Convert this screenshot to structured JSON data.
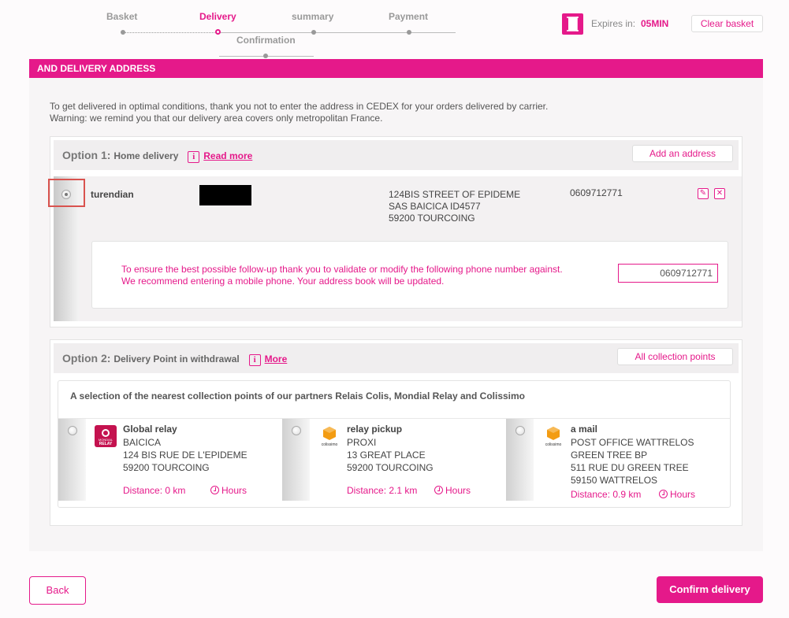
{
  "steps": [
    {
      "label": "Basket"
    },
    {
      "label": "Delivery"
    },
    {
      "label": "summary"
    },
    {
      "label": "Payment"
    },
    {
      "label": "Confirmation"
    }
  ],
  "expire": {
    "label": "Expires in:",
    "value": "05MIN"
  },
  "clear_basket": "Clear basket",
  "panel_title": "AND DELIVERY ADDRESS",
  "intro": [
    "To get delivered in optimal conditions, thank you not to enter the address in CEDEX for your orders delivered by carrier.",
    "Warning: we remind you that our delivery area covers only metropolitan France."
  ],
  "option1": {
    "prefix": "Option 1:",
    "title": "Home delivery",
    "link": "Read more",
    "add_button": "Add an address",
    "address": {
      "name": "turendian",
      "lines": [
        "124BIS STREET OF EPIDEME",
        "SAS BAICICA ID4577",
        "59200  TOURCOING"
      ],
      "phone": "0609712771"
    },
    "phone_message": "To ensure the best possible follow-up thank you to validate or modify the following phone number against. We recommend entering a mobile phone. Your address book will be updated.",
    "phone_value": "0609712771"
  },
  "option2": {
    "prefix": "Option 2:",
    "title": "Delivery Point in withdrawal",
    "link": "More",
    "all_button": "All collection points",
    "selection_title": "A selection of the nearest collection points of our partners Relais Colis, Mondial Relay and Colissimo",
    "relays": [
      {
        "name": "Global relay",
        "lines": [
          "BAICICA",
          "124 BIS RUE DE L'EPIDEME",
          "59200  TOURCOING"
        ],
        "distance": "Distance: 0 km",
        "hours": "Hours",
        "logo": "relay-logo-icon",
        "logo_text_1": "MONDIAL",
        "logo_text_2": "RELAY"
      },
      {
        "name": "relay pickup",
        "lines": [
          "PROXI",
          "13 GREAT PLACE",
          "59200  TOURCOING"
        ],
        "distance": "Distance: 2.1 km",
        "hours": "Hours",
        "logo": "colissimo-logo-icon",
        "logo_text": "colissimo"
      },
      {
        "name": "a mail",
        "lines": [
          "POST OFFICE WATTRELOS",
          "GREEN TREE BP",
          "511 RUE DU GREEN TREE",
          "59150  WATTRELOS"
        ],
        "distance": "Distance: 0.9 km",
        "hours": "Hours",
        "logo": "colissimo-logo-icon",
        "logo_text": "colissimo"
      }
    ]
  },
  "back_button": "Back",
  "confirm_button": "Confirm delivery",
  "colors": {
    "accent": "#e5198a"
  }
}
